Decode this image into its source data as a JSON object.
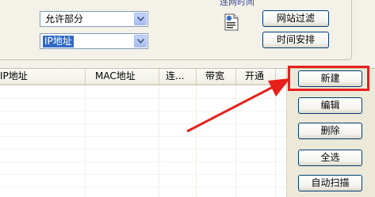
{
  "top": {
    "select_allow": "允许部分",
    "select_mode": "IP地址",
    "section_fragment": "连网时间",
    "btn_site_filter": "网站过滤",
    "btn_schedule": "时间安排"
  },
  "table": {
    "columns": [
      "IP地址",
      "MAC地址",
      "连...",
      "带宽",
      "开通"
    ]
  },
  "actions": {
    "new": "新建",
    "edit": "编辑",
    "delete": "删除",
    "select_all": "全选",
    "auto_scan": "自动扫描"
  },
  "colors": {
    "highlight_red": "#e8201c",
    "selection_blue": "#316ac5",
    "button_border": "#003c74"
  }
}
